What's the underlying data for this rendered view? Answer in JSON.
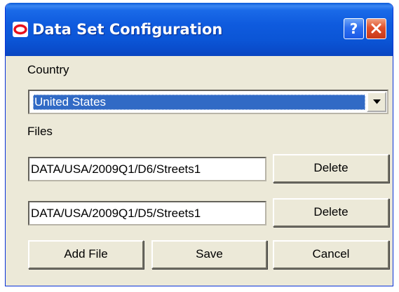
{
  "window": {
    "title": "Data Set Configuration",
    "help_label": "?",
    "colors": {
      "titlebar": "#0b55d6",
      "close_button": "#e0502a",
      "help_button": "#2d6ef0",
      "dialog_background": "#ece9d8",
      "selection": "#316ac5",
      "logo": "#e8101e"
    },
    "icons": {
      "logo": "oracle-logo-icon",
      "close": "close-icon",
      "dropdown": "chevron-down-icon"
    }
  },
  "country": {
    "label": "Country",
    "selected": "United States"
  },
  "files": {
    "label": "Files",
    "items": [
      {
        "path": "DATA/USA/2009Q1/D6/Streets1",
        "delete_label": "Delete"
      },
      {
        "path": "DATA/USA/2009Q1/D5/Streets1",
        "delete_label": "Delete"
      }
    ]
  },
  "actions": {
    "add_file": "Add File",
    "save": "Save",
    "cancel": "Cancel"
  }
}
